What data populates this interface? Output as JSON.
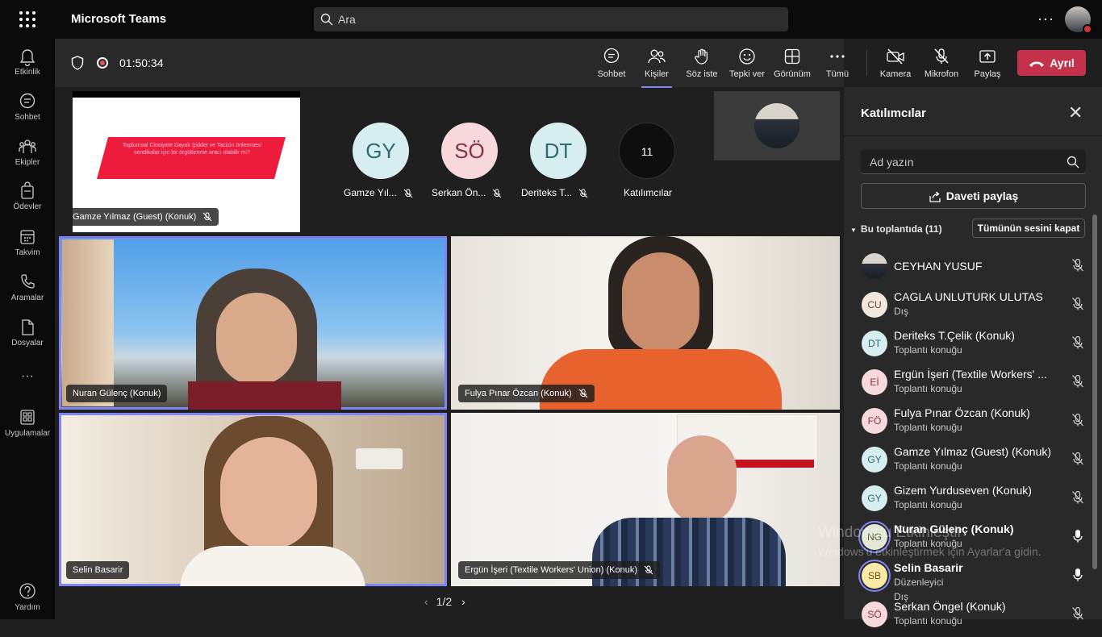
{
  "app": {
    "title": "Microsoft Teams"
  },
  "search": {
    "placeholder": "Ara"
  },
  "topbar": {
    "more_label": "···"
  },
  "rail": [
    {
      "label": "Etkinlik",
      "icon": "bell-icon"
    },
    {
      "label": "Sohbet",
      "icon": "chat-icon"
    },
    {
      "label": "Ekipler",
      "icon": "teams-icon"
    },
    {
      "label": "Ödevler",
      "icon": "assignments-icon"
    },
    {
      "label": "Takvim",
      "icon": "calendar-icon"
    },
    {
      "label": "Aramalar",
      "icon": "phone-icon"
    },
    {
      "label": "Dosyalar",
      "icon": "files-icon"
    },
    {
      "label": "Uygulamalar",
      "icon": "apps-icon"
    },
    {
      "label": "Yardım",
      "icon": "help-icon"
    }
  ],
  "callbar": {
    "timer": "01:50:34",
    "controls": [
      {
        "label": "Sohbet",
        "icon": "chat-icon"
      },
      {
        "label": "Kişiler",
        "icon": "people-icon"
      },
      {
        "label": "Söz iste",
        "icon": "raise-hand-icon"
      },
      {
        "label": "Tepki ver",
        "icon": "reaction-icon"
      },
      {
        "label": "Görünüm",
        "icon": "layout-icon"
      },
      {
        "label": "Tümü",
        "icon": "more-icon"
      },
      {
        "label": "Kamera",
        "icon": "camera-off-icon"
      },
      {
        "label": "Mikrofon",
        "icon": "mic-off-icon"
      },
      {
        "label": "Paylaş",
        "icon": "share-tray-icon"
      }
    ],
    "leave_label": "Ayrıl"
  },
  "stage": {
    "shared_content": {
      "slide_text": "Toplumsal Cinsiyete Dayalı Şiddet ve Tacizin önlenmesi sendikalar için bir örgütlenme aracı olabilir mi?",
      "presenter_label": "Gamze Yılmaz (Guest) (Konuk)"
    },
    "personas": [
      {
        "initials": "GY",
        "name": "Gamze Yıl...",
        "bg": "#d7eef0",
        "fg": "#2d6b72"
      },
      {
        "initials": "SÖ",
        "name": "Serkan Ön...",
        "bg": "#f7d9dd",
        "fg": "#8a3040"
      },
      {
        "initials": "DT",
        "name": "Deriteks T...",
        "bg": "#d7eef0",
        "fg": "#2d6b72"
      },
      {
        "initials": "11",
        "name": "Katılımcılar",
        "bg": "#0e0e0e",
        "fg": "#ffffff"
      }
    ],
    "tiles": [
      {
        "name": "Nuran Gülenç (Konuk)",
        "muted": false
      },
      {
        "name": "Fulya Pınar Özcan (Konuk)",
        "muted": true
      },
      {
        "name": "Selin Basarir",
        "muted": false
      },
      {
        "name": "Ergün İşeri (Textile Workers' Union) (Konuk)",
        "muted": true
      }
    ],
    "pager": "1/2"
  },
  "panel": {
    "title": "Katılımcılar",
    "search_placeholder": "Ad yazın",
    "invite_label": "Daveti paylaş",
    "section_label": "Bu toplantıda (11)",
    "mute_all_label": "Tümünün sesini kapat",
    "participants": [
      {
        "initials": "",
        "name": "CEYHAN YUSUF",
        "sub": "",
        "muted": true,
        "photo": true
      },
      {
        "initials": "CU",
        "name": "CAGLA UNLUTURK ULUTAS",
        "sub": "Dış",
        "muted": true,
        "bg": "#f2e7dc",
        "fg": "#6b4a2c"
      },
      {
        "initials": "DT",
        "name": "Deriteks T.Çelik (Konuk)",
        "sub": "Toplantı konuğu",
        "muted": true,
        "bg": "#d7eef0",
        "fg": "#2d6b72"
      },
      {
        "initials": "Eİ",
        "name": "Ergün İşeri (Textile Workers' ...",
        "sub": "Toplantı konuğu",
        "muted": true,
        "bg": "#f7d9dd",
        "fg": "#8a3040"
      },
      {
        "initials": "FÖ",
        "name": "Fulya Pınar Özcan (Konuk)",
        "sub": "Toplantı konuğu",
        "muted": true,
        "bg": "#f7d9dd",
        "fg": "#8a3040"
      },
      {
        "initials": "GY",
        "name": "Gamze Yılmaz (Guest) (Konuk)",
        "sub": "Toplantı konuğu",
        "muted": true,
        "bg": "#d7eef0",
        "fg": "#2d6b72"
      },
      {
        "initials": "GY",
        "name": "Gizem Yurduseven (Konuk)",
        "sub": "Toplantı konuğu",
        "muted": true,
        "bg": "#d7eef0",
        "fg": "#2d6b72"
      },
      {
        "initials": "NG",
        "name": "Nuran Gülenç (Konuk)",
        "sub": "Toplantı konuğu",
        "muted": false,
        "bg": "#e3e8d8",
        "fg": "#4d5a35",
        "speaking": true
      },
      {
        "initials": "SB",
        "name": "Selin Basarir",
        "sub": "Düzenleyici",
        "sub2": "Dış",
        "muted": false,
        "bg": "#fbe9a8",
        "fg": "#6b5210",
        "speaking": true
      },
      {
        "initials": "SÖ",
        "name": "Serkan Öngel (Konuk)",
        "sub": "Toplantı konuğu",
        "muted": true,
        "bg": "#f7d9dd",
        "fg": "#8a3040"
      }
    ]
  },
  "watermark": {
    "line1": "Windows'u Etkinleştir",
    "line2": "Windows'u etkinleştirmek için Ayarlar'a gidin."
  },
  "colors": {
    "accent": "#7f85f5",
    "leave": "#c4314b",
    "background": "#1f1f1f"
  }
}
